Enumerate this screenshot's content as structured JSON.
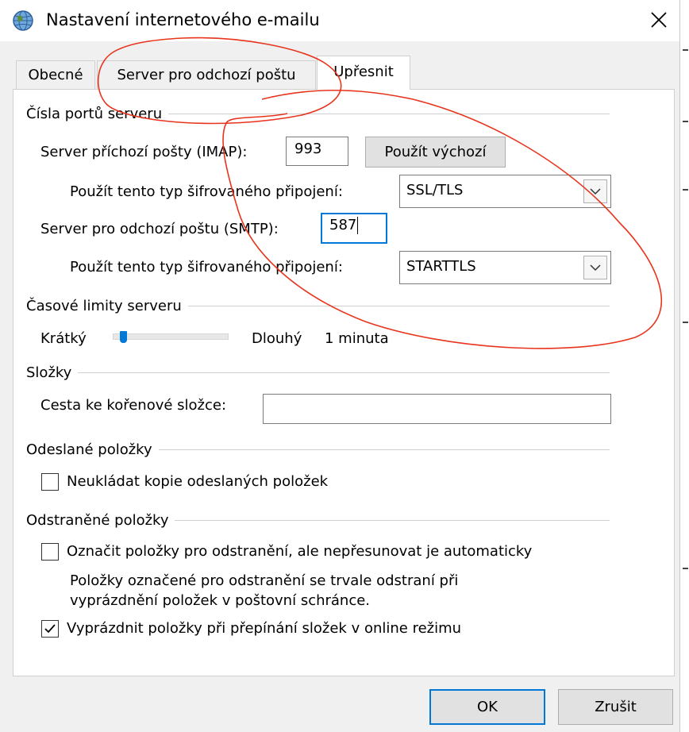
{
  "window": {
    "title": "Nastavení internetového e-mailu",
    "icon": "globe-mail-icon"
  },
  "tabs": [
    {
      "label": "Obecné",
      "active": false
    },
    {
      "label": "Server pro odchozí poštu",
      "active": false
    },
    {
      "label": "Upřesnit",
      "active": true
    }
  ],
  "ports": {
    "heading": "Čísla portů serveru",
    "incoming_label": "Server příchozí pošty (IMAP):",
    "incoming_value": "993",
    "default_button": "Použít výchozí",
    "enc1_label": "Použít tento typ šifrovaného připojení:",
    "enc1_value": "SSL/TLS",
    "outgoing_label": "Server pro odchozí poštu (SMTP):",
    "outgoing_value": "587",
    "enc2_label": "Použít tento typ šifrovaného připojení:",
    "enc2_value": "STARTTLS"
  },
  "timeouts": {
    "heading": "Časové limity serveru",
    "short_label": "Krátký",
    "long_label": "Dlouhý",
    "value": "1 minuta",
    "slider_fraction": 0.07
  },
  "folders": {
    "heading": "Složky",
    "root_label": "Cesta ke kořenové složce:",
    "root_value": ""
  },
  "sent": {
    "heading": "Odeslané položky",
    "dont_save_label": "Neukládat kopie odeslaných položek",
    "dont_save_checked": false
  },
  "deleted": {
    "heading": "Odstraněné položky",
    "mark_label": "Označit položky pro odstranění, ale nepřesunovat je automaticky",
    "mark_checked": false,
    "note_line1": "Položky označené pro odstranění se trvale odstraní při",
    "note_line2": "vyprázdnění položek v poštovní schránce.",
    "purge_label": "Vyprázdnit položky při přepínání složek v online režimu",
    "purge_checked": true
  },
  "footer": {
    "ok": "OK",
    "cancel": "Zrušit"
  },
  "colors": {
    "accent": "#0078d7",
    "annotation": "#e8341c",
    "dialog_bg": "#f0f0f0"
  }
}
